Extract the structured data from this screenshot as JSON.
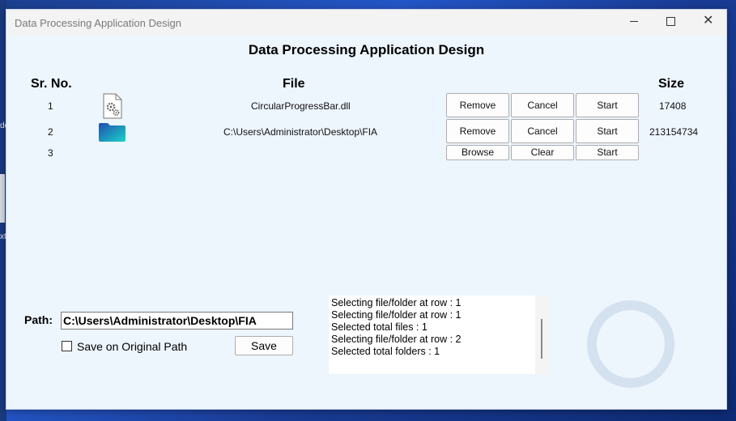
{
  "window": {
    "title": "Data Processing Application Design",
    "controls": {
      "minimize": "minimize-icon",
      "maximize": "maximize-icon",
      "close": "close-icon"
    }
  },
  "desktop": {
    "fragment_1": "de",
    "fragment_2": "xt"
  },
  "main": {
    "heading": "Data Processing Application Design",
    "columns": {
      "sr_no": "Sr. No.",
      "file": "File",
      "size": "Size"
    },
    "rows": [
      {
        "sr": "1",
        "icon": "settings-file-icon",
        "file": "CircularProgressBar.dll",
        "size": "17408",
        "buttons": [
          "Remove",
          "Cancel",
          "Start"
        ]
      },
      {
        "sr": "2",
        "icon": "folder-icon",
        "file": "C:\\Users\\Administrator\\Desktop\\FIA",
        "size": "213154734",
        "buttons": [
          "Remove",
          "Cancel",
          "Start"
        ]
      },
      {
        "sr": "3",
        "icon": "",
        "file": "",
        "size": "",
        "buttons": [
          "Browse",
          "Clear",
          "Start"
        ]
      }
    ]
  },
  "path_panel": {
    "label": "Path:",
    "value": "C:\\Users\\Administrator\\Desktop\\FIA",
    "checkbox_label": "Save on Original Path",
    "checkbox_checked": false,
    "save_label": "Save"
  },
  "log": {
    "lines": [
      "Selecting file/folder at row : 1",
      "Selecting file/folder at row : 1",
      "Selected total files : 1",
      "Selecting file/folder at row : 2",
      "Selected total folders : 1"
    ]
  },
  "progress": {
    "value": 0,
    "track_color": "#d4e1ef"
  },
  "colors": {
    "client_bg": "#edf5fd",
    "folder_gradient": [
      "#1f4fb0",
      "#1bd2c8"
    ]
  }
}
